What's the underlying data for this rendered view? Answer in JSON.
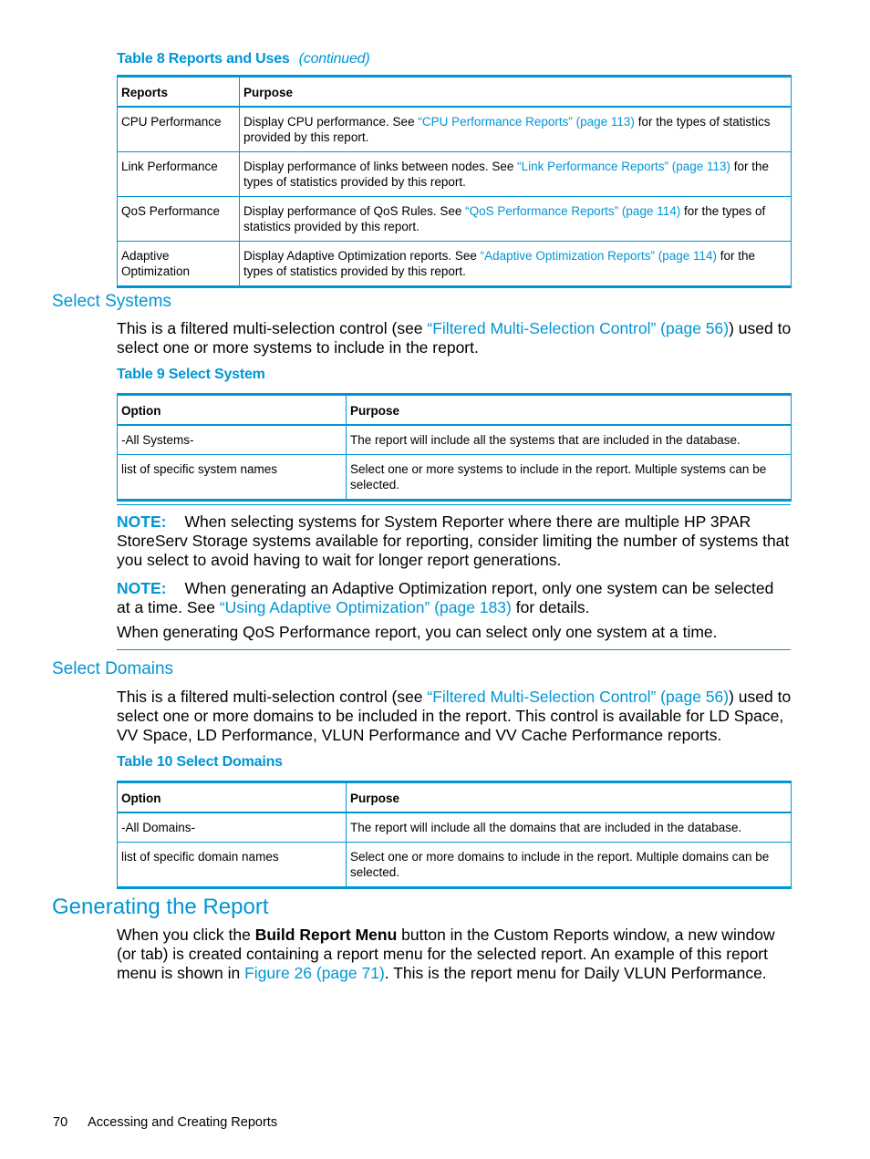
{
  "table8": {
    "caption": "Table 8 Reports and Uses",
    "continued": "(continued)",
    "headers": [
      "Reports",
      "Purpose"
    ],
    "rows": [
      {
        "report": "CPU Performance",
        "pre": "Display CPU performance. See ",
        "link": "“CPU Performance Reports” (page 113)",
        "post": " for the types of statistics provided by this report."
      },
      {
        "report": "Link Performance",
        "pre": "Display performance of links between nodes. See ",
        "link": "“Link Performance Reports” (page 113)",
        "post": " for the types of statistics provided by this report."
      },
      {
        "report": "QoS Performance",
        "pre": "Display performance of QoS Rules. See ",
        "link": "“QoS Performance Reports” (page 114)",
        "post": " for the types of statistics provided by this report."
      },
      {
        "report": "Adaptive Optimization",
        "pre": "Display Adaptive Optimization reports. See ",
        "link": "“Adaptive Optimization Reports” (page 114)",
        "post": " for the types of statistics provided by this report."
      }
    ]
  },
  "select_systems": {
    "heading": "Select Systems",
    "para_pre": "This is a filtered multi-selection control (see ",
    "para_link": "“Filtered Multi-Selection Control” (page 56)",
    "para_post": ") used to select one or more systems to include in the report."
  },
  "table9": {
    "caption": "Table 9 Select System",
    "headers": [
      "Option",
      "Purpose"
    ],
    "rows": [
      {
        "option": "-All Systems-",
        "purpose": "The report will include all the systems that are included in the database."
      },
      {
        "option": "list of specific system names",
        "purpose": "Select one or more systems to include in the report. Multiple systems can be selected."
      }
    ]
  },
  "notes": {
    "note1_label": "NOTE:",
    "note1_text": "When selecting systems for System Reporter where there are multiple HP 3PAR StoreServ Storage systems available for reporting, consider limiting the number of systems that you select to avoid having to wait for longer report generations.",
    "note2_label": "NOTE:",
    "note2_pre": "When generating an Adaptive Optimization report, only one system can be selected at a time. See ",
    "note2_link": "“Using Adaptive Optimization” (page 183)",
    "note2_post": " for details.",
    "note2_extra": "When generating QoS Performance report, you can select only one system at a time."
  },
  "select_domains": {
    "heading": "Select Domains",
    "para_pre": "This is a filtered multi-selection control (see ",
    "para_link": "“Filtered Multi-Selection Control” (page 56)",
    "para_post": ") used to select one or more domains to be included in the report. This control is available for LD Space, VV Space, LD Performance, VLUN Performance and VV Cache Performance reports."
  },
  "table10": {
    "caption": "Table 10 Select Domains",
    "headers": [
      "Option",
      "Purpose"
    ],
    "rows": [
      {
        "option": "-All Domains-",
        "purpose": "The report will include all the domains that are included in the database."
      },
      {
        "option": "list of specific domain names",
        "purpose": "Select one or more domains to include in the report. Multiple domains can be selected."
      }
    ]
  },
  "generating": {
    "heading": "Generating the Report",
    "pre": "When you click the ",
    "bold": "Build Report Menu",
    "mid": " button in the Custom Reports window, a new window (or tab) is created containing a report menu for the selected report. An example of this report menu is shown in ",
    "link": "Figure 26 (page 71)",
    "post": ". This is the report menu for Daily VLUN Performance."
  },
  "footer": {
    "page_number": "70",
    "chapter": "Accessing and Creating Reports"
  }
}
